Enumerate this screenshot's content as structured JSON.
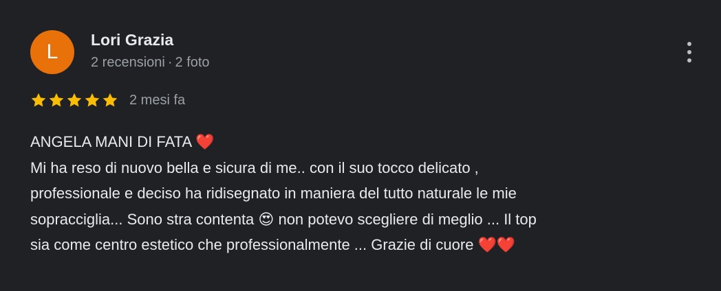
{
  "reviewer": {
    "initial": "L",
    "avatar_color": "#e8710a",
    "name": "Lori Grazia",
    "reviews_count": "2 recensioni",
    "separator": "·",
    "photos_count": "2 foto"
  },
  "review": {
    "rating": 5,
    "max_rating": 5,
    "star_color": "#fbbc04",
    "date": "2 mesi fa",
    "text": "ANGELA MANI DI FATA ❤️\nMi ha reso di nuovo bella e sicura di me.. con il suo tocco delicato ,\nprofessionale e deciso ha ridisegnato in maniera del tutto naturale le mie\nsopracciglia... Sono stra contenta 😍 non potevo scegliere di meglio ... Il top\nsia come centro estetico che professionalmente ... Grazie di cuore ❤️❤️"
  },
  "actions": {
    "more_icon": "more-vert-icon"
  }
}
